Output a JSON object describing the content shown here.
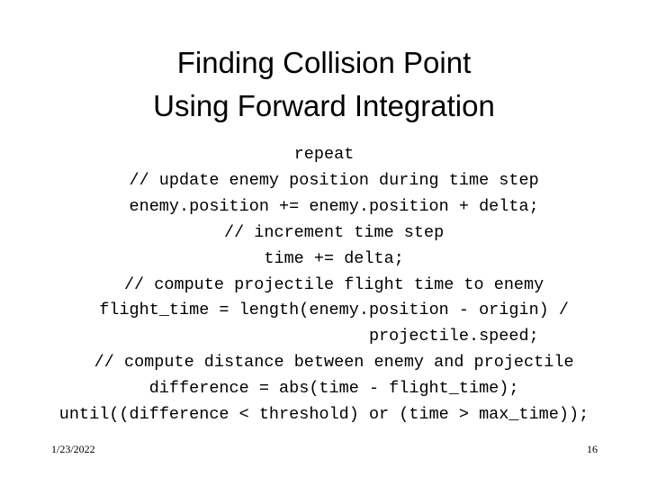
{
  "slide": {
    "background_color": "#ffffff",
    "text_color": "#000000",
    "title": {
      "line1": "Finding Collision Point",
      "line2": "Using Forward Integration"
    },
    "code": {
      "language": "pseudocode",
      "lines": [
        "repeat",
        "  // update enemy position during time step",
        "  enemy.position += enemy.position + delta;",
        "  // increment time step",
        "  time += delta;",
        "  // compute projectile flight time to enemy",
        "  flight_time = length(enemy.position - origin) /",
        "                          projectile.speed;",
        "  // compute distance between enemy and projectile",
        "  difference = abs(time - flight_time);",
        "until((difference < threshold) or (time > max_time));"
      ]
    },
    "footer": {
      "date": "1/23/2022",
      "page_number": "16"
    }
  }
}
